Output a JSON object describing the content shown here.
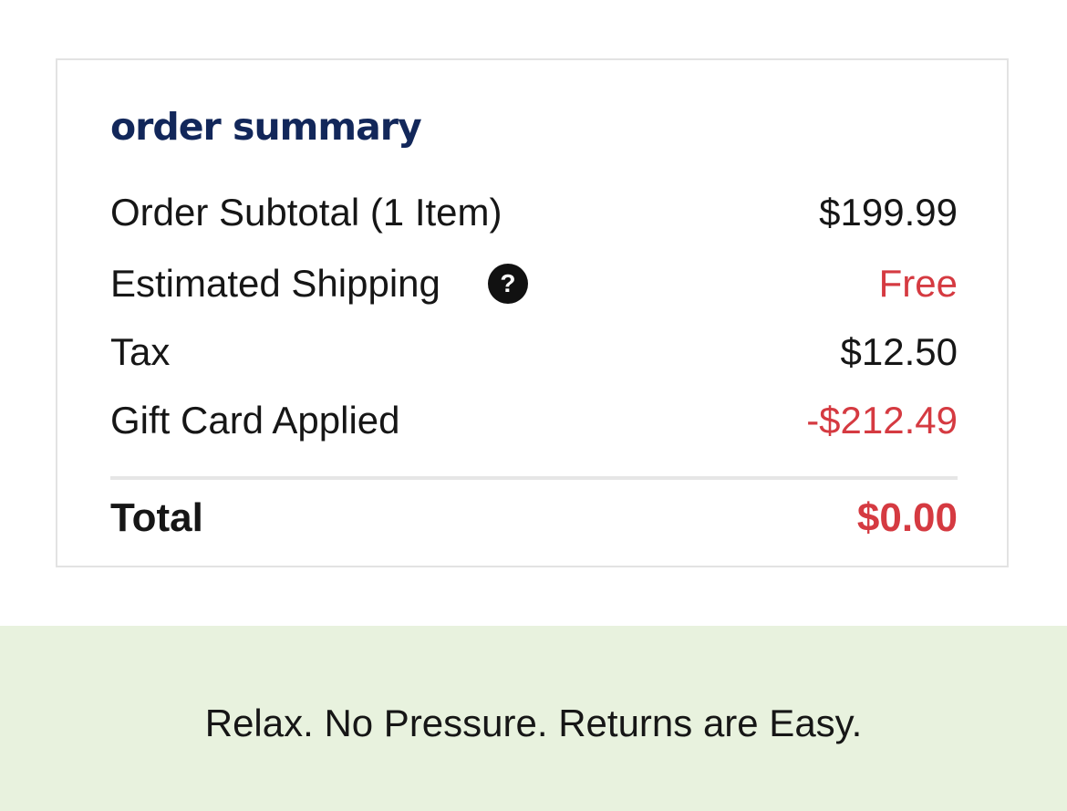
{
  "summary": {
    "title": "order summary",
    "rows": [
      {
        "label": "Order Subtotal (1 Item)",
        "value": "$199.99"
      },
      {
        "label": "Estimated Shipping",
        "value": "Free",
        "help_icon": "question-circle-icon"
      },
      {
        "label": "Tax",
        "value": "$12.50"
      },
      {
        "label": "Gift Card Applied",
        "value": "-$212.49"
      }
    ],
    "total": {
      "label": "Total",
      "value": "$0.00"
    }
  },
  "banner": {
    "text": "Relax. No Pressure. Returns are Easy."
  },
  "colors": {
    "title": "#12275a",
    "accent_red": "#d53a41",
    "banner_bg": "#e8f2de"
  }
}
